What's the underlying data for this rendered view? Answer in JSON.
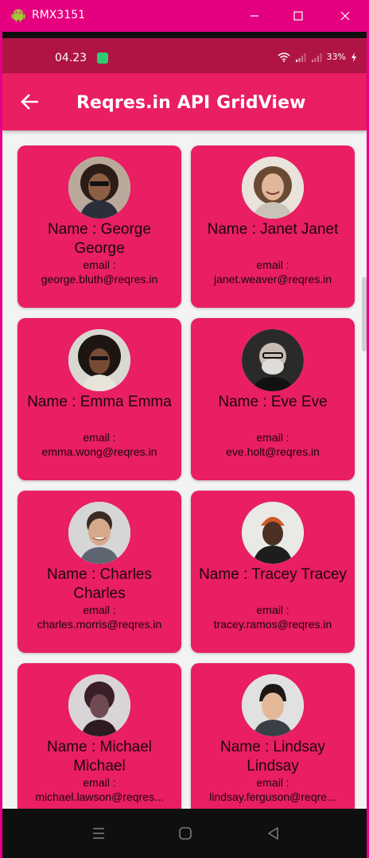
{
  "window": {
    "title": "RMX3151",
    "minimize_icon": "minimize-icon",
    "maximize_icon": "maximize-icon",
    "close_icon": "close-icon"
  },
  "status_bar": {
    "time": "04.23",
    "battery": "33%"
  },
  "app_bar": {
    "title": "Reqres.in API GridView",
    "back_icon": "arrow-back-icon"
  },
  "colors": {
    "accent": "#e91e63",
    "status_bar": "#b01445",
    "window_chrome": "#e4007f"
  },
  "users": [
    {
      "name": "Name : George George",
      "email_label": "email :",
      "email": "george.bluth@reqres.in"
    },
    {
      "name": "Name : Janet Janet",
      "email_label": "email :",
      "email": "janet.weaver@reqres.in"
    },
    {
      "name": "Name : Emma Emma",
      "email_label": "email :",
      "email": "emma.wong@reqres.in"
    },
    {
      "name": "Name : Eve Eve",
      "email_label": "email :",
      "email": "eve.holt@reqres.in"
    },
    {
      "name": "Name : Charles Charles",
      "email_label": "email :",
      "email": "charles.morris@reqres.in"
    },
    {
      "name": "Name : Tracey Tracey",
      "email_label": "email :",
      "email": "tracey.ramos@reqres.in"
    },
    {
      "name": "Name : Michael Michael",
      "email_label": "email :",
      "email": "michael.lawson@reqres..."
    },
    {
      "name": "Name : Lindsay Lindsay",
      "email_label": "email :",
      "email": "lindsay.ferguson@reqre..."
    }
  ]
}
